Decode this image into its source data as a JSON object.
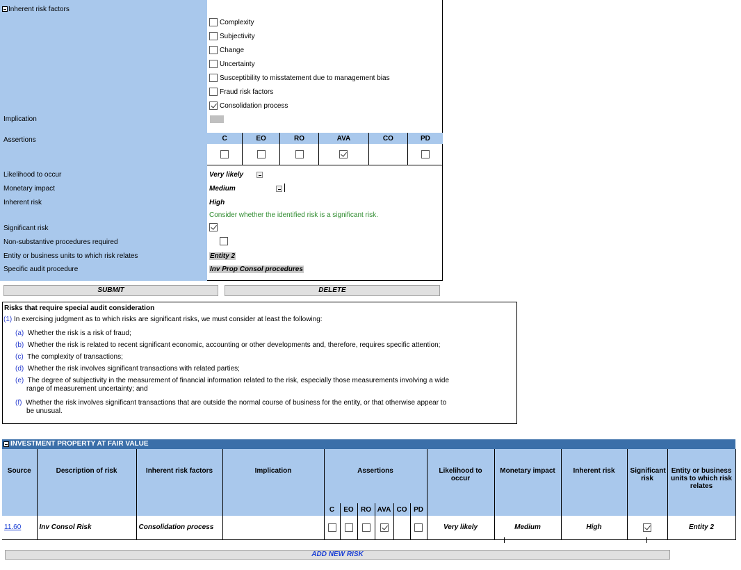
{
  "form": {
    "inherent_risk_factors_label": "Inherent risk factors",
    "factors": [
      {
        "label": "Complexity",
        "checked": false
      },
      {
        "label": "Subjectivity",
        "checked": false
      },
      {
        "label": "Change",
        "checked": false
      },
      {
        "label": "Uncertainty",
        "checked": false
      },
      {
        "label": "Susceptibility to misstatement due to management bias",
        "checked": false
      },
      {
        "label": "Fraud risk factors",
        "checked": false
      },
      {
        "label": "Consolidation process",
        "checked": true
      }
    ],
    "implication_label": "Implication",
    "assertions_label": "Assertions",
    "assertions": [
      {
        "code": "C",
        "checked": false
      },
      {
        "code": "EO",
        "checked": false
      },
      {
        "code": "RO",
        "checked": false
      },
      {
        "code": "AVA",
        "checked": true
      },
      {
        "code": "CO",
        "checked": null
      },
      {
        "code": "PD",
        "checked": false
      }
    ],
    "likelihood_label": "Likelihood to occur",
    "likelihood_value": "Very likely",
    "monetary_label": "Monetary impact",
    "monetary_value": "Medium",
    "inherent_risk_label": "Inherent risk",
    "inherent_risk_value": "High",
    "significant_note": "Consider whether the identified risk is a significant risk.",
    "significant_label": "Significant risk",
    "significant_checked": true,
    "nonsubstantive_label": "Non-substantive procedures required",
    "nonsubstantive_checked": false,
    "entity_label": "Entity or business units to which risk relates",
    "entity_value": "Entity 2",
    "procedure_label": "Specific audit procedure",
    "procedure_value": "Inv Prop Consol procedures",
    "submit_label": "SUBMIT",
    "delete_label": "DELETE"
  },
  "guidance": {
    "title": "Risks that require special audit consideration",
    "intro_num": "(1)",
    "intro": "In exercising judgment as to which risks are significant risks, we must consider at least the following:",
    "items": [
      {
        "letter": "(a)",
        "text": "Whether the risk is a risk of fraud;"
      },
      {
        "letter": "(b)",
        "text": "Whether the risk is related to recent significant economic, accounting or other developments and, therefore, requires specific attention;"
      },
      {
        "letter": "(c)",
        "text": "The complexity of transactions;"
      },
      {
        "letter": "(d)",
        "text": "Whether the risk involves significant transactions with related parties;"
      },
      {
        "letter": "(e)",
        "text": "The degree of subjectivity in the measurement of financial information related to the risk, especially those measurements involving a wide",
        "text2": "range of measurement uncertainty; and"
      },
      {
        "letter": "(f)",
        "text": "Whether the risk involves significant transactions that are outside the normal course of business for the entity, or that otherwise appear to",
        "text2": "be unusual."
      }
    ]
  },
  "summary": {
    "section_title": "INVESTMENT PROPERTY AT FAIR VALUE",
    "headers": {
      "source": "Source",
      "description": "Description of risk",
      "factors": "Inherent risk factors",
      "implication": "Implication",
      "assertions": "Assertions",
      "likelihood": "Likelihood to occur",
      "monetary": "Monetary impact",
      "inherent": "Inherent risk",
      "significant": "Significant risk",
      "entity": "Entity or business units to which risk relates"
    },
    "assertion_codes": [
      "C",
      "EO",
      "RO",
      "AVA",
      "CO",
      "PD"
    ],
    "row": {
      "source": "11.60",
      "description": "Inv Consol Risk",
      "factors": "Consolidation process",
      "implication": "",
      "assertions": [
        false,
        false,
        false,
        true,
        null,
        false
      ],
      "likelihood": "Very likely",
      "monetary": "Medium",
      "inherent": "High",
      "significant": true,
      "entity": "Entity 2"
    },
    "add_label": "ADD NEW RISK"
  }
}
